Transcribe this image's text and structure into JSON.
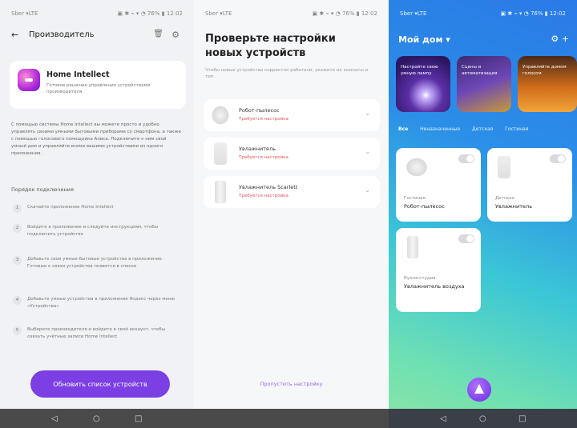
{
  "screen1": {
    "status_left": "Sber ▾LTE",
    "status_right": "▣ ✱ ⌁ ▾ ◔ 76% ▮ 12:02",
    "back_glyph": "←",
    "title": "Производитель",
    "brand": {
      "name": "Home Intellect",
      "description": "Готовое решение управления устройствами производителя."
    },
    "intro": "С помощью системы Home Intellect вы можете просто и удобно управлять своими умными бытовыми приборами со смартфона, а также с помощью голосового помощника Алиса. Подключите к ним свой умный дом и управляйте всеми вашими устройствами из одного приложения.",
    "steps_title": "Порядок подключения",
    "steps": [
      {
        "num": "1",
        "text": "Скачайте приложение Home Intellect"
      },
      {
        "num": "2",
        "text": "Войдите в приложение и следуйте инструкциям, чтобы подключить устройство"
      },
      {
        "num": "3",
        "text": "Добавьте свои умные бытовые устройства в приложение. Готовые к связи устройства появятся в списке"
      },
      {
        "num": "4",
        "text": "Добавьте умные устройства в приложение Яндекс через меню «Устройства»"
      },
      {
        "num": "5",
        "text": "Выберите производителя и войдите в свой аккаунт, чтобы связать учётные записи Home Intellect"
      }
    ],
    "update_button": "Обновить список устройств",
    "nav": [
      "◁",
      "○",
      "□"
    ]
  },
  "screen2": {
    "status_left": "Sber ▾LTE",
    "status_right": "▣ ✱ ⌁ ▾ ◔ 76% ▮ 12:02",
    "title": "Проверьте настройки новых устройств",
    "subtitle": "Чтобы новые устройства корректно работали, укажите их комнаты и тип.",
    "devices": [
      {
        "name": "Робот-пылесос",
        "status": "Требуется настройка"
      },
      {
        "name": "Увлажнитель",
        "status": "Требуется настройка"
      },
      {
        "name": "Увлажнитель Scarlett",
        "status": "Требуется настройка"
      }
    ],
    "chevron": "⌄",
    "skip_link": "Пропустить настройку"
  },
  "screen3": {
    "status_left": "Sber ▾LTE",
    "status_right": "▣ ✱ ⌁ ▾ ◔ 76% ▮ 12:02",
    "title": "Мой дом ▾",
    "top_icons": "⚙ +",
    "stories": [
      "Настройте свою умную лампу",
      "Сцены и автоматизация",
      "Управляйте домом голосом"
    ],
    "tabs": [
      "Все",
      "Неназначенные",
      "Детская",
      "Гостиная"
    ],
    "tiles": [
      {
        "room": "Гостиная",
        "name": "Робот-пылесос"
      },
      {
        "room": "Детская",
        "name": "Увлажнитель"
      },
      {
        "room": "Кухня-студия",
        "name": "Увлажнитель воздуха"
      }
    ],
    "nav": [
      "◁",
      "○",
      "□"
    ]
  }
}
